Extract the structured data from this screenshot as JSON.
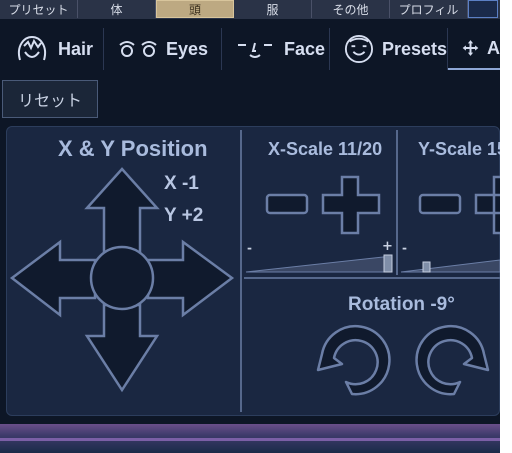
{
  "category_tabs": [
    {
      "label": "プリセット",
      "selected": false
    },
    {
      "label": "体",
      "selected": false
    },
    {
      "label": "頭",
      "selected": true
    },
    {
      "label": "服",
      "selected": false
    },
    {
      "label": "その他",
      "selected": false
    },
    {
      "label": "プロフィル",
      "selected": false
    }
  ],
  "nav_tabs": [
    {
      "label": "Hair",
      "icon": "hair-icon"
    },
    {
      "label": "Eyes",
      "icon": "eyes-icon"
    },
    {
      "label": "Face",
      "icon": "face-icon"
    },
    {
      "label": "Presets",
      "icon": "presets-icon"
    },
    {
      "label": "A",
      "icon": "move-arrows-icon",
      "active": true
    }
  ],
  "reset_label": "リセット",
  "position": {
    "title": "X & Y Position",
    "x_readout": "X -1",
    "y_readout": "Y +2"
  },
  "x_scale": {
    "title": "X-Scale 11/20",
    "value": 11,
    "max": 20,
    "minus_label": "-",
    "plus_label": "+"
  },
  "y_scale": {
    "title": "Y-Scale 15",
    "minus_label": "-"
  },
  "rotation": {
    "title": "Rotation -9°"
  },
  "colors": {
    "background": "#0d1626",
    "panel": "#1a2741",
    "accent": "#8ea7d6",
    "selected_tab": "#bda982"
  }
}
